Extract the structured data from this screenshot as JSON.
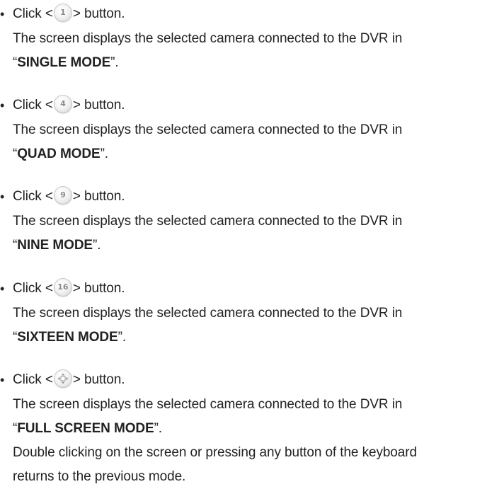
{
  "items": [
    {
      "click_prefix": "Click <",
      "icon_label": "1",
      "icon_name": "single-mode-icon",
      "click_suffix": "> button.",
      "desc": "The screen displays the selected camera connected to the DVR in",
      "mode_open_quote": "“",
      "mode_name": "SINGLE MODE",
      "mode_close_quote": "”."
    },
    {
      "click_prefix": "Click <",
      "icon_label": "4",
      "icon_name": "quad-mode-icon",
      "click_suffix": "> button.",
      "desc": "The screen displays the selected camera connected to the DVR in",
      "mode_open_quote": "“",
      "mode_name": "QUAD MODE",
      "mode_close_quote": "”."
    },
    {
      "click_prefix": "Click <",
      "icon_label": "9",
      "icon_name": "nine-mode-icon",
      "click_suffix": "> button.",
      "desc": "The screen displays the selected camera connected to the DVR in",
      "mode_open_quote": "“",
      "mode_name": "NINE MODE",
      "mode_close_quote": "”."
    },
    {
      "click_prefix": "Click <",
      "icon_label": "16",
      "icon_name": "sixteen-mode-icon",
      "click_suffix": "> button.",
      "desc": "The screen displays the selected camera connected to the DVR in",
      "mode_open_quote": "“",
      "mode_name": "SIXTEEN MODE",
      "mode_close_quote": "”."
    },
    {
      "click_prefix": "Click <",
      "icon_label": "",
      "icon_name": "full-screen-move-icon",
      "click_suffix": "> button.",
      "desc": "The screen displays the selected camera connected to the DVR in",
      "mode_open_quote": "“",
      "mode_name": "FULL SCREEN MODE",
      "mode_close_quote": "”.",
      "extra_line_1": "Double clicking on the screen or pressing any button of the keyboard",
      "extra_line_2": "returns to the previous mode."
    }
  ],
  "bullet_char": "•"
}
